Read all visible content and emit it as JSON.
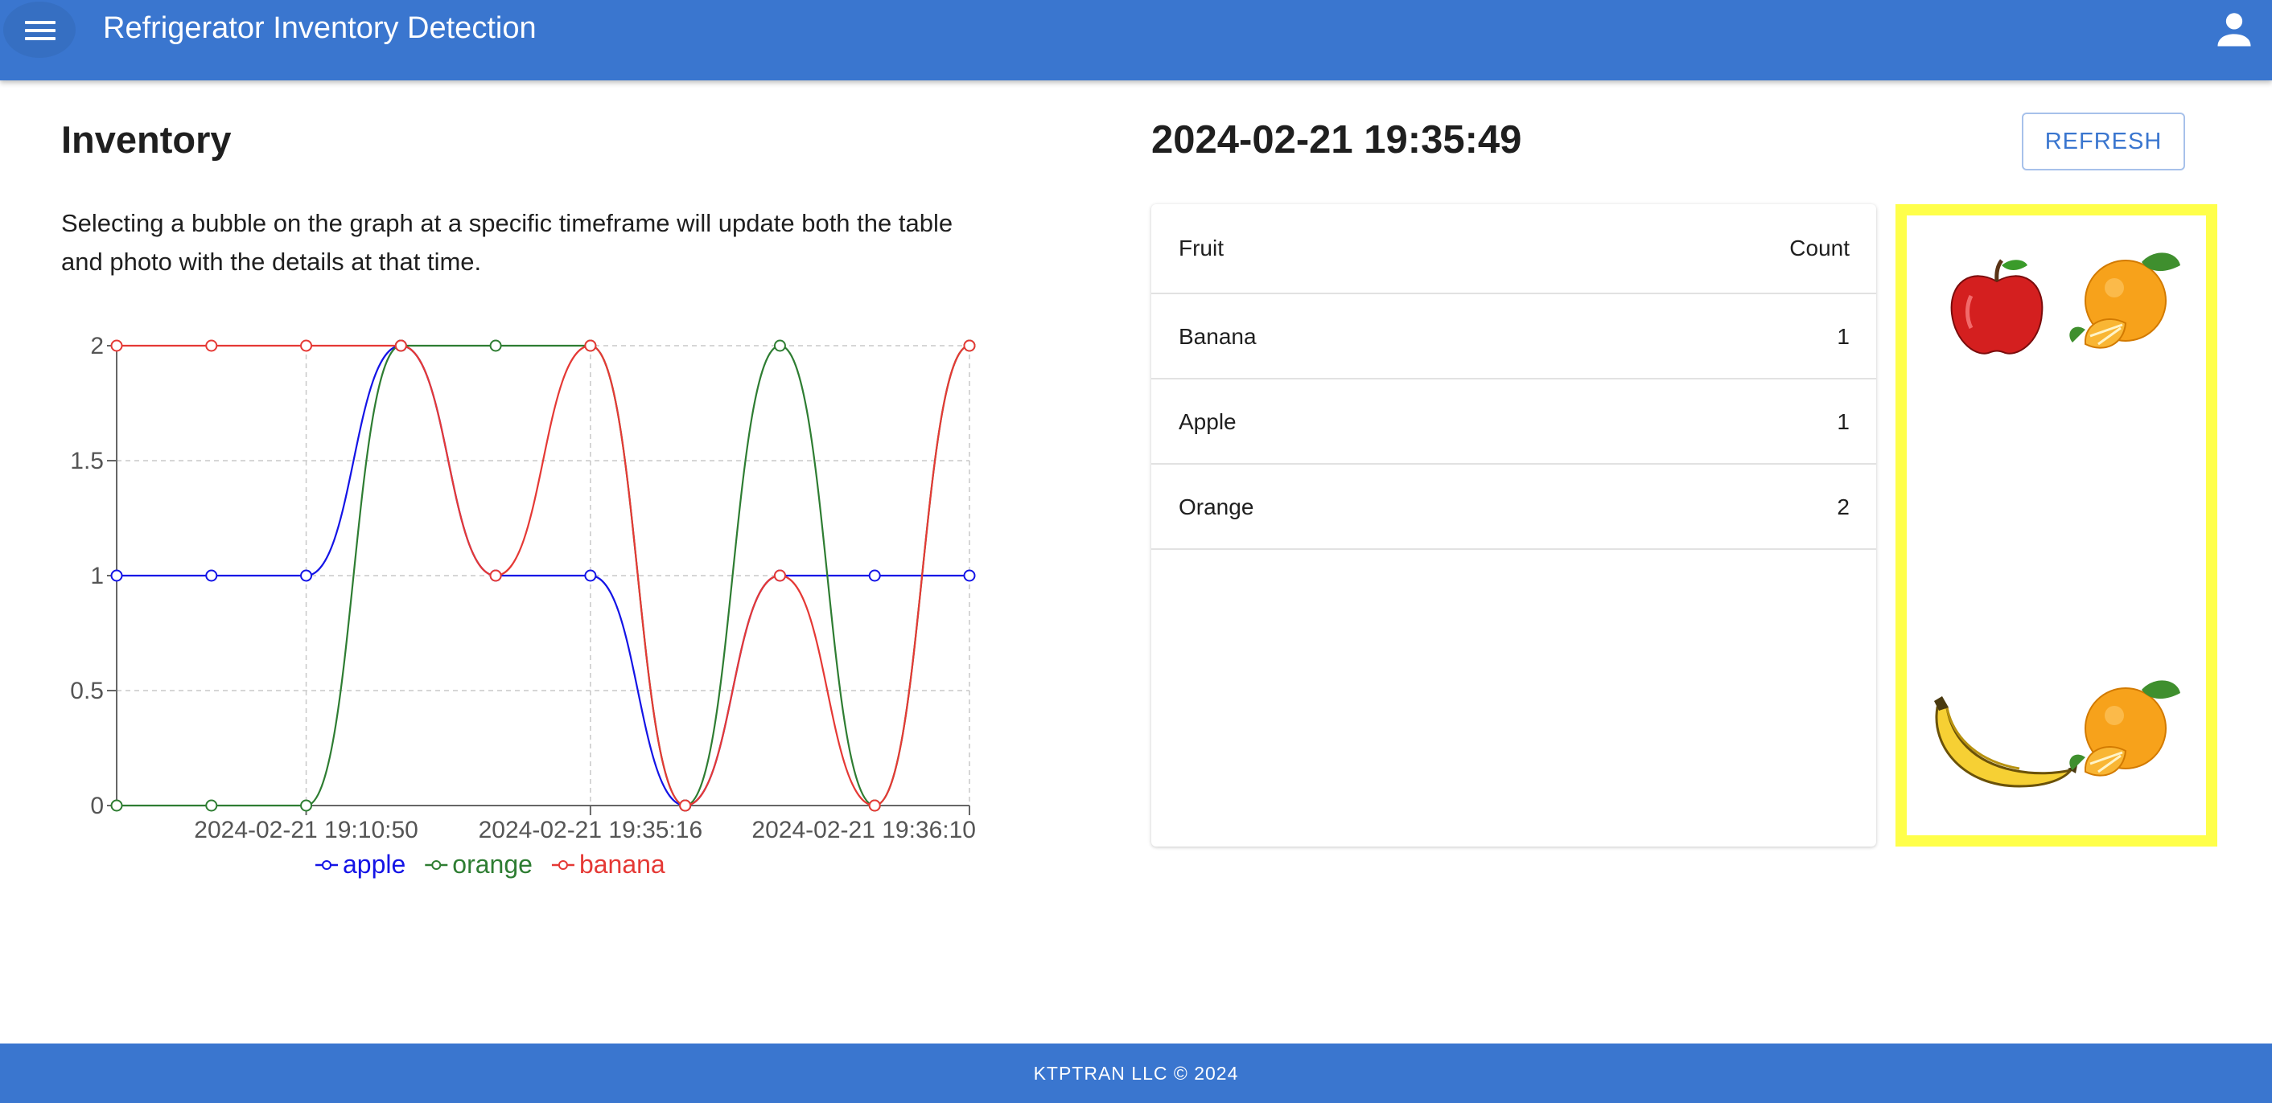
{
  "header": {
    "title": "Refrigerator Inventory Detection",
    "menu_icon": "menu-icon",
    "account_icon": "account-icon",
    "background_color": "#3a76cf"
  },
  "inventory": {
    "heading": "Inventory",
    "description": "Selecting a bubble on the graph at a specific timeframe will update both the table and photo with the details at that time."
  },
  "chart_data": {
    "type": "line",
    "x": [
      0,
      1,
      2,
      3,
      4,
      5,
      6,
      7,
      8,
      9
    ],
    "x_tick_labels": [
      {
        "index": 2,
        "label": "2024-02-21 19:10:50"
      },
      {
        "index": 5,
        "label": "2024-02-21 19:35:16"
      },
      {
        "index": 9,
        "label": "2024-02-21 19:36:10"
      }
    ],
    "y_ticks": [
      "0",
      "0.5",
      "1",
      "1.5",
      "2"
    ],
    "ylim": [
      0,
      2
    ],
    "grid": true,
    "legend_position": "bottom",
    "series": [
      {
        "name": "apple",
        "color": "#1414e6",
        "values": [
          1,
          1,
          1,
          2,
          1,
          1,
          0,
          1,
          1,
          1
        ]
      },
      {
        "name": "orange",
        "color": "#2e7d32",
        "values": [
          0,
          0,
          0,
          2,
          2,
          2,
          0,
          2,
          0,
          2
        ]
      },
      {
        "name": "banana",
        "color": "#e53935",
        "values": [
          2,
          2,
          2,
          2,
          1,
          2,
          0,
          1,
          0,
          2
        ]
      }
    ]
  },
  "snapshot": {
    "timestamp": "2024-02-21 19:35:49",
    "refresh_label": "REFRESH",
    "table": {
      "headers": [
        "Fruit",
        "Count"
      ],
      "rows": [
        {
          "fruit": "Banana",
          "count": "1"
        },
        {
          "fruit": "Apple",
          "count": "1"
        },
        {
          "fruit": "Orange",
          "count": "2"
        }
      ]
    },
    "photo": {
      "border_color": "#ffff4a",
      "items": [
        "apple-image",
        "orange-image",
        "banana-image",
        "orange-image"
      ]
    }
  },
  "footer": {
    "text": "KTPTRAN LLC © 2024"
  }
}
